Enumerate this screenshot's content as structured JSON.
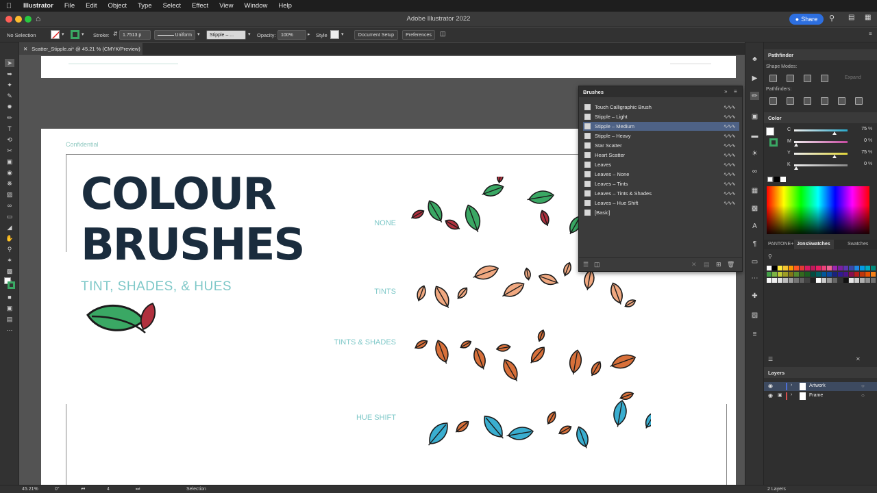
{
  "menubar": {
    "items": [
      "Illustrator",
      "File",
      "Edit",
      "Object",
      "Type",
      "Select",
      "Effect",
      "View",
      "Window",
      "Help"
    ]
  },
  "titlebar": {
    "title": "Adobe Illustrator 2022",
    "share_label": "Share"
  },
  "controlbar": {
    "selection_label": "No Selection",
    "stroke_label": "Stroke:",
    "stroke_value": "1.7513 p",
    "stroke_profile": "Uniform",
    "brush_value": "Stipple – ...",
    "opacity_label": "Opacity:",
    "opacity_value": "100%",
    "style_label": "Style",
    "document_setup_label": "Document Setup",
    "preferences_label": "Preferences"
  },
  "document_tab": {
    "label": "Scatter_Stipple.ai* @ 45.21 % (CMYK/Preview)"
  },
  "artwork": {
    "confidential": "Confidential",
    "title_line1": "COLOUR",
    "title_line2": "BRUSHES",
    "subtitle": "TINT, SHADES, & HUES",
    "row_labels": [
      "NONE",
      "TINTS",
      "TINTS & SHADES",
      "HUE SHIFT"
    ]
  },
  "brushes_panel": {
    "title": "Brushes",
    "items": [
      {
        "label": "Touch Calligraphic Brush"
      },
      {
        "label": "Stipple – Light"
      },
      {
        "label": "Stipple – Medium"
      },
      {
        "label": "Stipple – Heavy"
      },
      {
        "label": "Star Scatter"
      },
      {
        "label": "Heart Scatter"
      },
      {
        "label": "Leaves"
      },
      {
        "label": "Leaves – None"
      },
      {
        "label": "Leaves – Tints"
      },
      {
        "label": "Leaves – Tints & Shades"
      },
      {
        "label": "Leaves – Hue Shift"
      },
      {
        "label": "[Basic]"
      }
    ],
    "selected_index": 2
  },
  "pathfinder_panel": {
    "title": "Pathfinder",
    "shape_modes_label": "Shape Modes:",
    "pathfinders_label": "Pathfinders:",
    "expand_label": "Expand"
  },
  "color_panel": {
    "title": "Color",
    "channels": [
      {
        "name": "C",
        "value": "75",
        "color": "#2aa8c9"
      },
      {
        "name": "M",
        "value": "0",
        "color": "#c64aa0"
      },
      {
        "name": "Y",
        "value": "75",
        "color": "#e0d43a"
      },
      {
        "name": "K",
        "value": "0",
        "color": "#888888"
      }
    ]
  },
  "swatches_tabs": [
    "PANTONE+",
    "JonsSwatches",
    "Swatches"
  ],
  "layers_panel": {
    "title": "Layers",
    "layers": [
      {
        "name": "Artwork",
        "color": "#4e6fd6"
      },
      {
        "name": "Frame",
        "color": "#d64e4e"
      }
    ],
    "count_label": "2 Layers"
  },
  "statusbar": {
    "zoom": "45.21%",
    "rotation": "0°",
    "artboard_number": "4",
    "tool_label": "Selection"
  },
  "colors": {
    "accent_blue": "#2d6fe0",
    "leaf_green": "#3aa864",
    "leaf_red": "#b0303e",
    "leaf_tint": "#f0a880",
    "leaf_shade": "#d8703a",
    "leaf_hue": "#3aaed0"
  }
}
